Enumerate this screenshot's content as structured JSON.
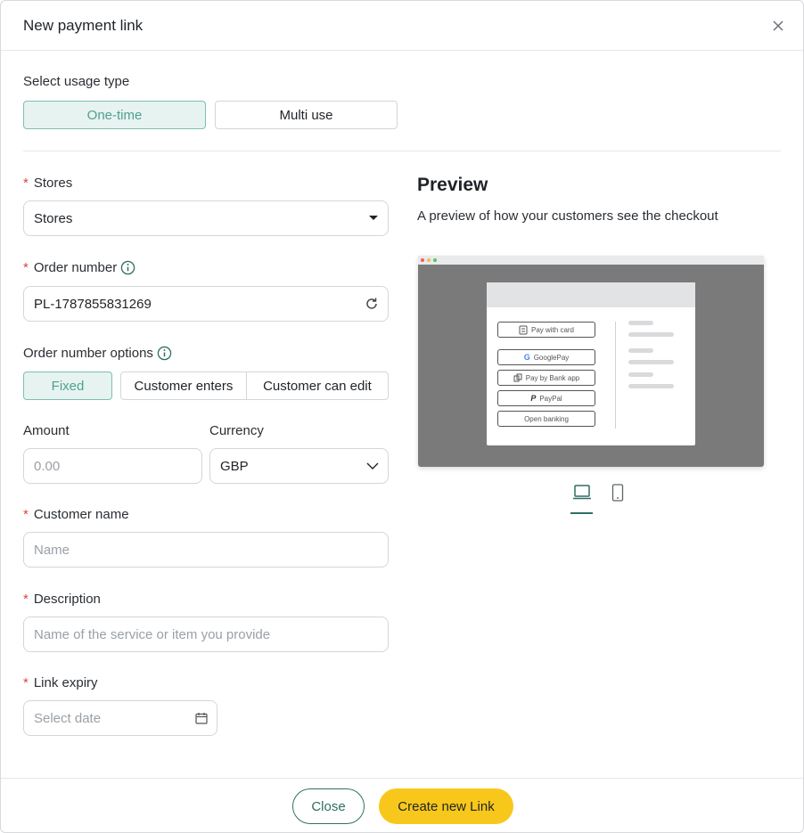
{
  "modal": {
    "title": "New payment link"
  },
  "usage": {
    "label": "Select usage type",
    "options": [
      "One-time",
      "Multi use"
    ],
    "selected": "One-time"
  },
  "stores": {
    "label": "Stores",
    "value": "Stores"
  },
  "order_number": {
    "label": "Order number",
    "value": "PL-1787855831269"
  },
  "order_options": {
    "label": "Order number options",
    "options": [
      "Fixed",
      "Customer enters",
      "Customer can edit"
    ],
    "selected": "Fixed"
  },
  "amount": {
    "label": "Amount",
    "placeholder": "0.00"
  },
  "currency": {
    "label": "Currency",
    "value": "GBP"
  },
  "customer_name": {
    "label": "Customer name",
    "placeholder": "Name"
  },
  "description": {
    "label": "Description",
    "placeholder": "Name of the service or item you provide"
  },
  "link_expiry": {
    "label": "Link expiry",
    "placeholder": "Select date"
  },
  "preview": {
    "title": "Preview",
    "subtitle": "A preview of how your customers see the checkout",
    "payment_buttons": [
      "Pay with card",
      "GooglePay",
      "Pay by Bank app",
      "PayPal",
      "Open banking"
    ],
    "selected_device": "desktop"
  },
  "footer": {
    "close_label": "Close",
    "create_label": "Create new Link"
  },
  "colors": {
    "accent": "#2f6f63",
    "primary_button": "#f7c71b",
    "active_toggle_bg": "#e6f3f0",
    "required": "#e0433c"
  }
}
